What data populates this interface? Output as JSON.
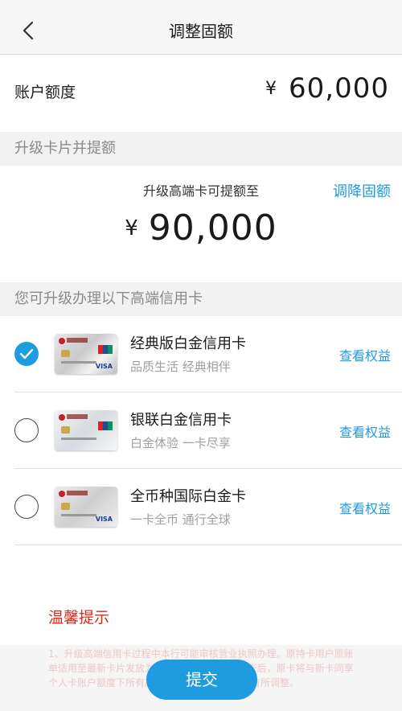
{
  "nav": {
    "title": "调整固额"
  },
  "account": {
    "label": "账户额度",
    "currency": "¥",
    "amount": "60,000"
  },
  "upgrade_section": {
    "header": "升级卡片并提额",
    "caption": "升级高端卡可提额至",
    "adjust_link": "调降固额",
    "currency": "¥",
    "amount": "90,000"
  },
  "cards_section": {
    "header": "您可升级办理以下高端信用卡",
    "cards": [
      {
        "title": "经典版白金信用卡",
        "subtitle": "品质生活 经典相伴",
        "link": "查看权益",
        "selected": true
      },
      {
        "title": "银联白金信用卡",
        "subtitle": "白金体验 一卡尽享",
        "link": "查看权益",
        "selected": false
      },
      {
        "title": "全币种国际白金卡",
        "subtitle": "一卡全币 通行全球",
        "link": "查看权益",
        "selected": false
      }
    ]
  },
  "tips": {
    "title": "温馨提示",
    "text": "1、升级高端信用卡过程中本行可能审核营业执照办理。原持卡用户原账单适用至最新卡片发放为准。2、成功持有高端卡后，原卡将与新卡同享个人卡账户额度下所有高端信用卡，固定额度将有所调整。"
  },
  "actions": {
    "submit_label": "提交"
  },
  "colors": {
    "accent": "#1f9be0",
    "tips_red": "#d9281e"
  }
}
